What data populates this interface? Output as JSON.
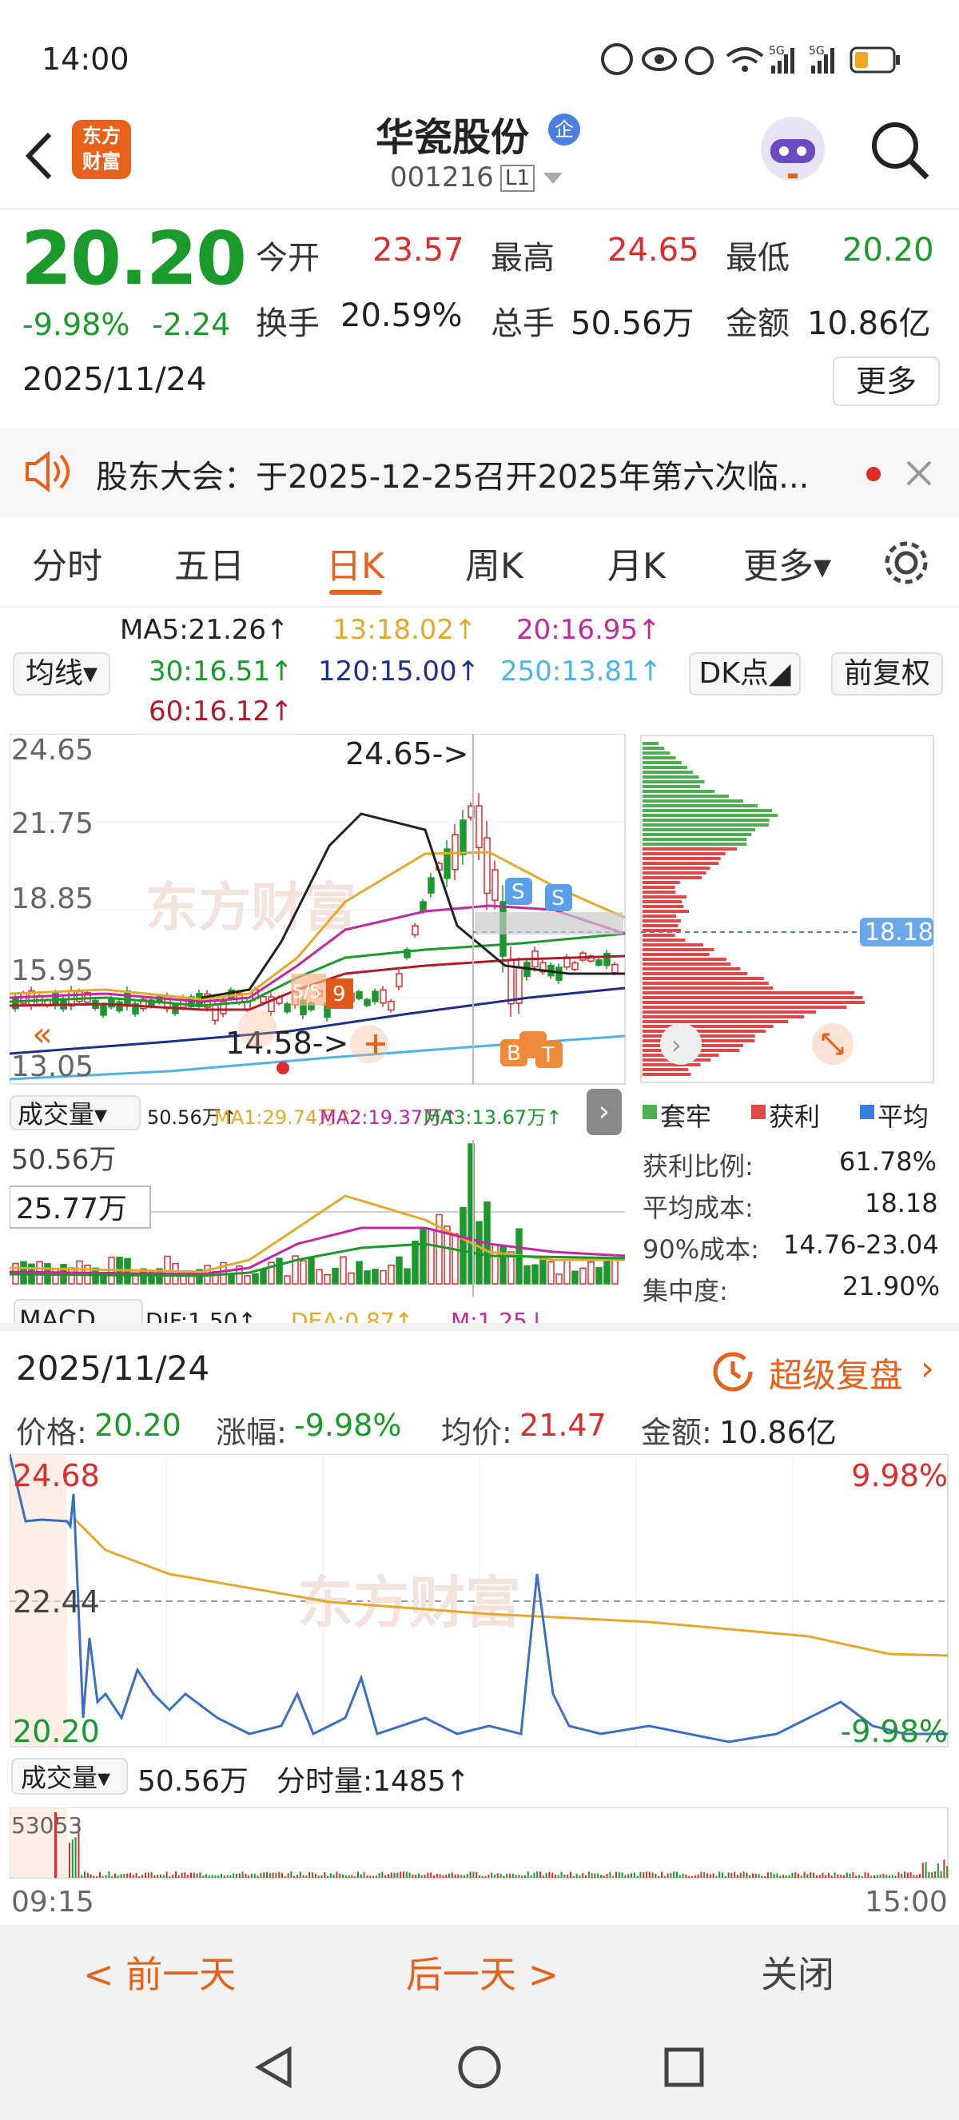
{
  "status_bar": {
    "time": "14:00",
    "net1": "5G",
    "net2": "5G"
  },
  "header": {
    "logo_line1": "东方",
    "logo_line2": "财富",
    "title": "华瓷股份",
    "title_badge": "企",
    "code": "001216",
    "level": "L1"
  },
  "quote": {
    "price": "20.20",
    "change_pct": "-9.98%",
    "change": "-2.24",
    "date": "2025/11/24",
    "open_label": "今开",
    "open": "23.57",
    "high_label": "最高",
    "high": "24.65",
    "low_label": "最低",
    "low": "20.20",
    "turnover_label": "换手",
    "turnover": "20.59%",
    "volume_label": "总手",
    "volume": "50.56万",
    "amount_label": "金额",
    "amount": "10.86亿",
    "more_label": "更多"
  },
  "notice": {
    "text": "股东大会：于2025-12-25召开2025年第六次临..."
  },
  "tabs": [
    {
      "label": "分时"
    },
    {
      "label": "五日"
    },
    {
      "label": "日K"
    },
    {
      "label": "周K"
    },
    {
      "label": "月K"
    },
    {
      "label": "更多▾"
    }
  ],
  "ma_legend": {
    "ma5": "MA5:21.26↑",
    "ma13": "13:18.02↑",
    "ma20": "20:16.95↑",
    "ma30": "30:16.51↑",
    "ma120": "120:15.00↑",
    "ma250": "250:13.81↑",
    "ma60": "60:16.12↑",
    "select_label": "均线▾",
    "dk_label": "DK点◢",
    "adjust_label": "前复权"
  },
  "kchart": {
    "y_labels": [
      "24.65",
      "21.75",
      "18.85",
      "15.95",
      "13.05"
    ],
    "high_annot": "24.65->",
    "low_annot": "14.58->",
    "watermark": "东方财富",
    "marker_labels": [
      "S",
      "S",
      "B",
      "T",
      "T",
      "9",
      "5/5"
    ]
  },
  "volume": {
    "label": "成交量▾",
    "vol": "50.56万↑",
    "ma1": "MA1:29.74万↑",
    "ma2": "MA2:19.37万↑",
    "ma3": "MA3:13.67万↑",
    "max": "50.56万",
    "cursor": "25.77万"
  },
  "macd": {
    "label": "MACD",
    "dif": "DIF:1.50↑",
    "dea": "DEA:0.87↑",
    "m": "M:1.25↓"
  },
  "chip": {
    "cost_line": "18.18",
    "legend": [
      "套牢",
      "获利",
      "平均"
    ],
    "rows": [
      {
        "k": "获利比例:",
        "v": "61.78%"
      },
      {
        "k": "平均成本:",
        "v": "18.18"
      },
      {
        "k": "90%成本:",
        "v": "14.76-23.04"
      },
      {
        "k": "集中度:",
        "v": "21.90%"
      }
    ]
  },
  "panel": {
    "date": "2025/11/24",
    "replay": "超级复盘",
    "price_label": "价格:",
    "price": "20.20",
    "pct_label": "涨幅:",
    "pct": "-9.98%",
    "avg_label": "均价:",
    "avg": "21.47",
    "amt_label": "金额:",
    "amt": "10.86亿",
    "y_top": "24.68",
    "y_mid": "22.44",
    "y_bot": "20.20",
    "pct_top": "9.98%",
    "pct_bot": "-9.98%",
    "vol_label": "成交量▾",
    "vol_total": "50.56万",
    "tick_label": "分时量:1485↑",
    "vol_max": "53053",
    "t_start": "09:15",
    "t_end": "15:00",
    "watermark": "东方财富"
  },
  "bottom": {
    "prev": "< 前一天",
    "next": "后一天 >",
    "close": "关闭"
  },
  "colors": {
    "up": "#e02b2b",
    "down": "#1a9a2b",
    "accent": "#e8611a",
    "navy": "#1d2f8a"
  }
}
